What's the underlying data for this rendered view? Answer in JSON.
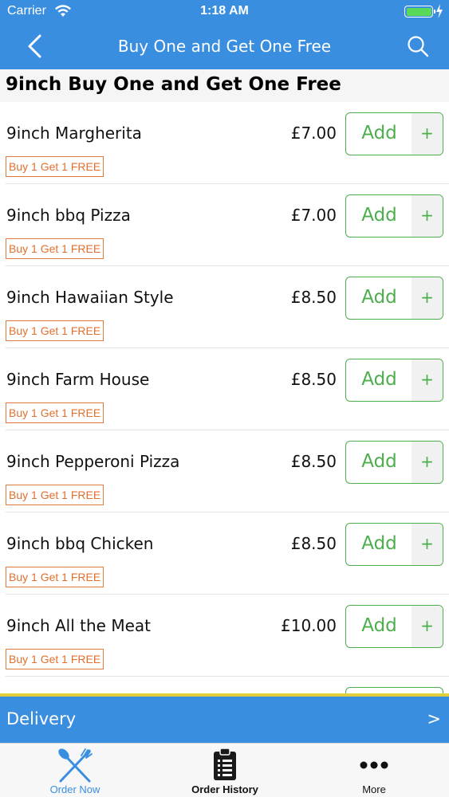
{
  "status_bar": {
    "carrier": "Carrier",
    "time": "1:18 AM"
  },
  "nav": {
    "title": "Buy One and Get One Free"
  },
  "section": {
    "title": "9inch Buy One and Get One Free"
  },
  "items": [
    {
      "name": "9inch Margherita",
      "price": "£7.00",
      "badge": "Buy 1 Get 1 FREE",
      "add_label": "Add",
      "plus": "+"
    },
    {
      "name": "9inch bbq Pizza",
      "price": "£7.00",
      "badge": "Buy 1 Get 1 FREE",
      "add_label": "Add",
      "plus": "+"
    },
    {
      "name": "9inch Hawaiian Style",
      "price": "£8.50",
      "badge": "Buy 1 Get 1 FREE",
      "add_label": "Add",
      "plus": "+"
    },
    {
      "name": "9inch Farm House",
      "price": "£8.50",
      "badge": "Buy 1 Get 1 FREE",
      "add_label": "Add",
      "plus": "+"
    },
    {
      "name": "9inch Pepperoni Pizza",
      "price": "£8.50",
      "badge": "Buy 1 Get 1 FREE",
      "add_label": "Add",
      "plus": "+"
    },
    {
      "name": "9inch bbq Chicken",
      "price": "£8.50",
      "badge": "Buy 1 Get 1 FREE",
      "add_label": "Add",
      "plus": "+"
    },
    {
      "name": "9inch All the Meat",
      "price": "£10.00",
      "badge": "Buy 1 Get 1 FREE",
      "add_label": "Add",
      "plus": "+"
    }
  ],
  "delivery": {
    "label": "Delivery",
    "arrow": ">"
  },
  "tabs": [
    {
      "label": "Order Now",
      "icon": "fork-knife-icon",
      "active": true
    },
    {
      "label": "Order History",
      "icon": "clipboard-icon",
      "active": false
    },
    {
      "label": "More",
      "icon": "more-dots-icon",
      "active": false
    }
  ],
  "colors": {
    "nav_blue": "#3a8ee0",
    "add_green": "#4cae4c",
    "badge_orange": "#e0702e",
    "battery_green": "#5ad85a"
  }
}
